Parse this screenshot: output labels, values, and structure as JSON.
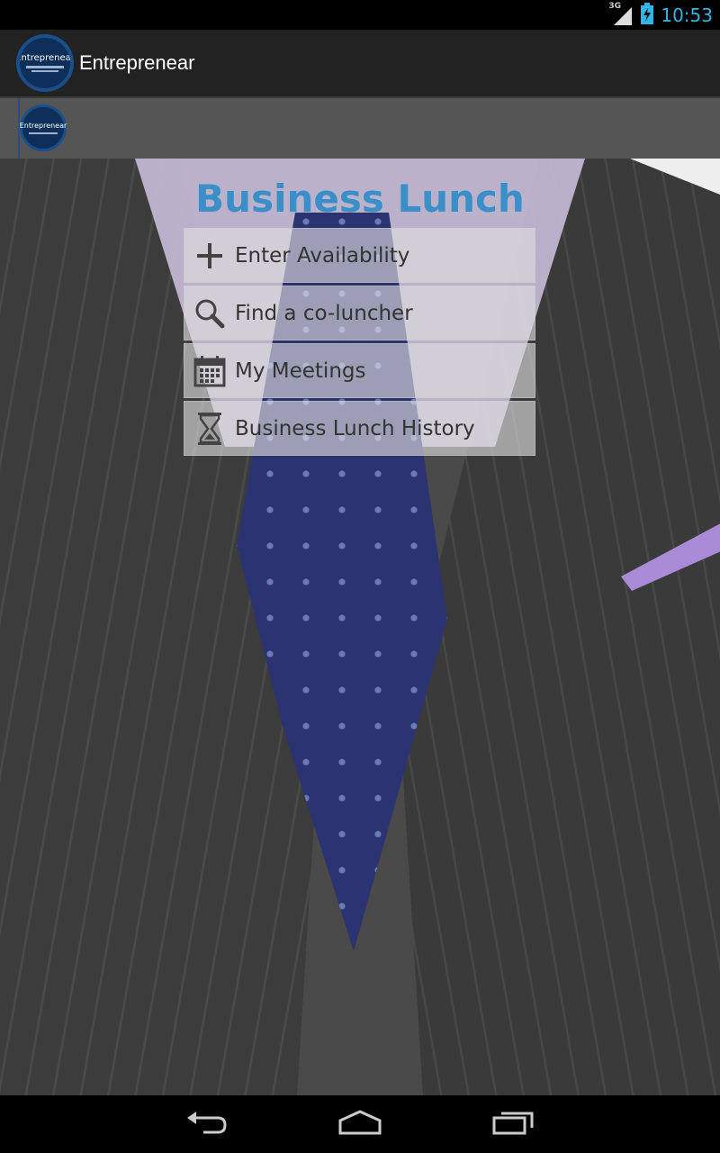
{
  "status_bar": {
    "network": "3G",
    "time": "10:53"
  },
  "action_bar": {
    "title": "Entreprenear",
    "logo_text": "Entreprenear"
  },
  "secondary_bar": {
    "logo_text": "Entreprenear"
  },
  "main": {
    "heading": "Business Lunch",
    "menu": [
      {
        "label": "Enter Availability",
        "icon": "plus-icon"
      },
      {
        "label": "Find a co-luncher",
        "icon": "search-icon"
      },
      {
        "label": "My Meetings",
        "icon": "calendar-icon"
      },
      {
        "label": "Business Lunch History",
        "icon": "hourglass-icon"
      }
    ]
  },
  "nav_bar": {
    "buttons": [
      "back-icon",
      "home-icon",
      "recent-apps-icon"
    ]
  },
  "colors": {
    "accent": "#33b5e5",
    "heading": "#3a8fc8",
    "action_bar": "#222222",
    "secondary_bar": "#555555"
  }
}
